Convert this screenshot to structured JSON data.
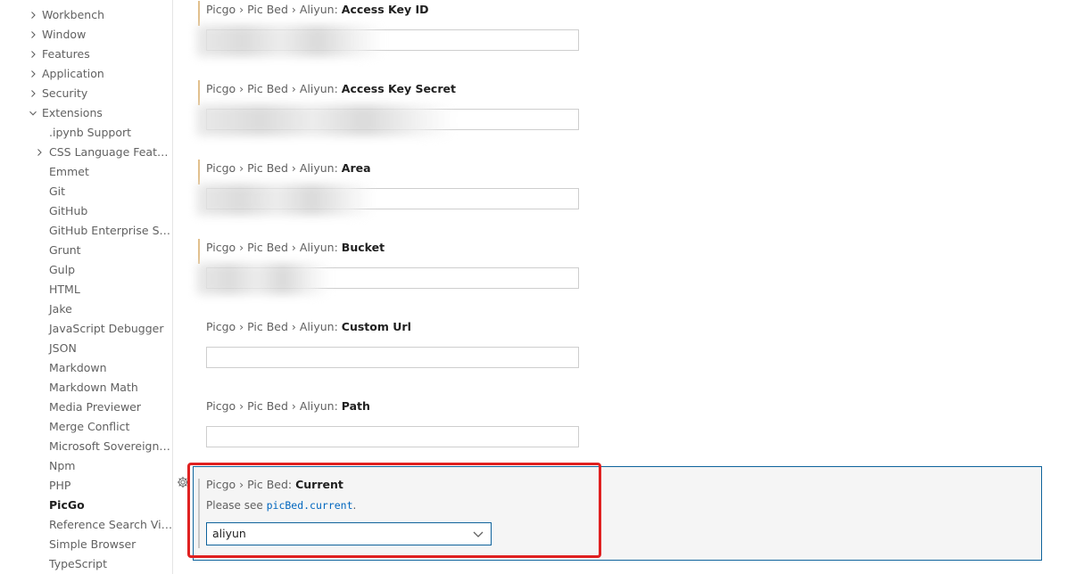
{
  "sidebar": {
    "items": [
      {
        "label": "Workbench",
        "level": 0,
        "twisty": "right"
      },
      {
        "label": "Window",
        "level": 0,
        "twisty": "right"
      },
      {
        "label": "Features",
        "level": 0,
        "twisty": "right"
      },
      {
        "label": "Application",
        "level": 0,
        "twisty": "right"
      },
      {
        "label": "Security",
        "level": 0,
        "twisty": "right"
      },
      {
        "label": "Extensions",
        "level": 0,
        "twisty": "down"
      },
      {
        "label": ".ipynb Support",
        "level": 1
      },
      {
        "label": "CSS Language Features",
        "level": 1,
        "twisty": "right"
      },
      {
        "label": "Emmet",
        "level": 1
      },
      {
        "label": "Git",
        "level": 1
      },
      {
        "label": "GitHub",
        "level": 1
      },
      {
        "label": "GitHub Enterprise Ser...",
        "level": 1
      },
      {
        "label": "Grunt",
        "level": 1
      },
      {
        "label": "Gulp",
        "level": 1
      },
      {
        "label": "HTML",
        "level": 1
      },
      {
        "label": "Jake",
        "level": 1
      },
      {
        "label": "JavaScript Debugger",
        "level": 1
      },
      {
        "label": "JSON",
        "level": 1
      },
      {
        "label": "Markdown",
        "level": 1
      },
      {
        "label": "Markdown Math",
        "level": 1
      },
      {
        "label": "Media Previewer",
        "level": 1
      },
      {
        "label": "Merge Conflict",
        "level": 1
      },
      {
        "label": "Microsoft Sovereign C...",
        "level": 1
      },
      {
        "label": "Npm",
        "level": 1
      },
      {
        "label": "PHP",
        "level": 1
      },
      {
        "label": "PicGo",
        "level": 1,
        "active": true
      },
      {
        "label": "Reference Search View",
        "level": 1
      },
      {
        "label": "Simple Browser",
        "level": 1
      },
      {
        "label": "TypeScript",
        "level": 1
      }
    ]
  },
  "settings": [
    {
      "prefix": "Picgo › Pic Bed › Aliyun: ",
      "key": "Access Key ID",
      "value": "",
      "modified": true,
      "redacted": true
    },
    {
      "prefix": "Picgo › Pic Bed › Aliyun: ",
      "key": "Access Key Secret",
      "value": "",
      "modified": true,
      "redacted": true
    },
    {
      "prefix": "Picgo › Pic Bed › Aliyun: ",
      "key": "Area",
      "value": "",
      "modified": true,
      "redacted": true
    },
    {
      "prefix": "Picgo › Pic Bed › Aliyun: ",
      "key": "Bucket",
      "value": "",
      "modified": true,
      "redacted": true
    },
    {
      "prefix": "Picgo › Pic Bed › Aliyun: ",
      "key": "Custom Url",
      "value": "",
      "modified": false,
      "redacted": false
    },
    {
      "prefix": "Picgo › Pic Bed › Aliyun: ",
      "key": "Path",
      "value": "",
      "modified": false,
      "redacted": false
    }
  ],
  "current": {
    "prefix": "Picgo › Pic Bed: ",
    "key": "Current",
    "description_prefix": "Please see ",
    "description_link": "picBed.current",
    "description_suffix": ".",
    "selected": "aliyun"
  },
  "icons": {
    "gear": "gear-icon",
    "chevron": "chevron-down-icon"
  },
  "colors": {
    "modified_bar": "#e2c08d",
    "focus_border": "#0e639c",
    "link": "#0066bf",
    "highlight": "#e02020"
  }
}
